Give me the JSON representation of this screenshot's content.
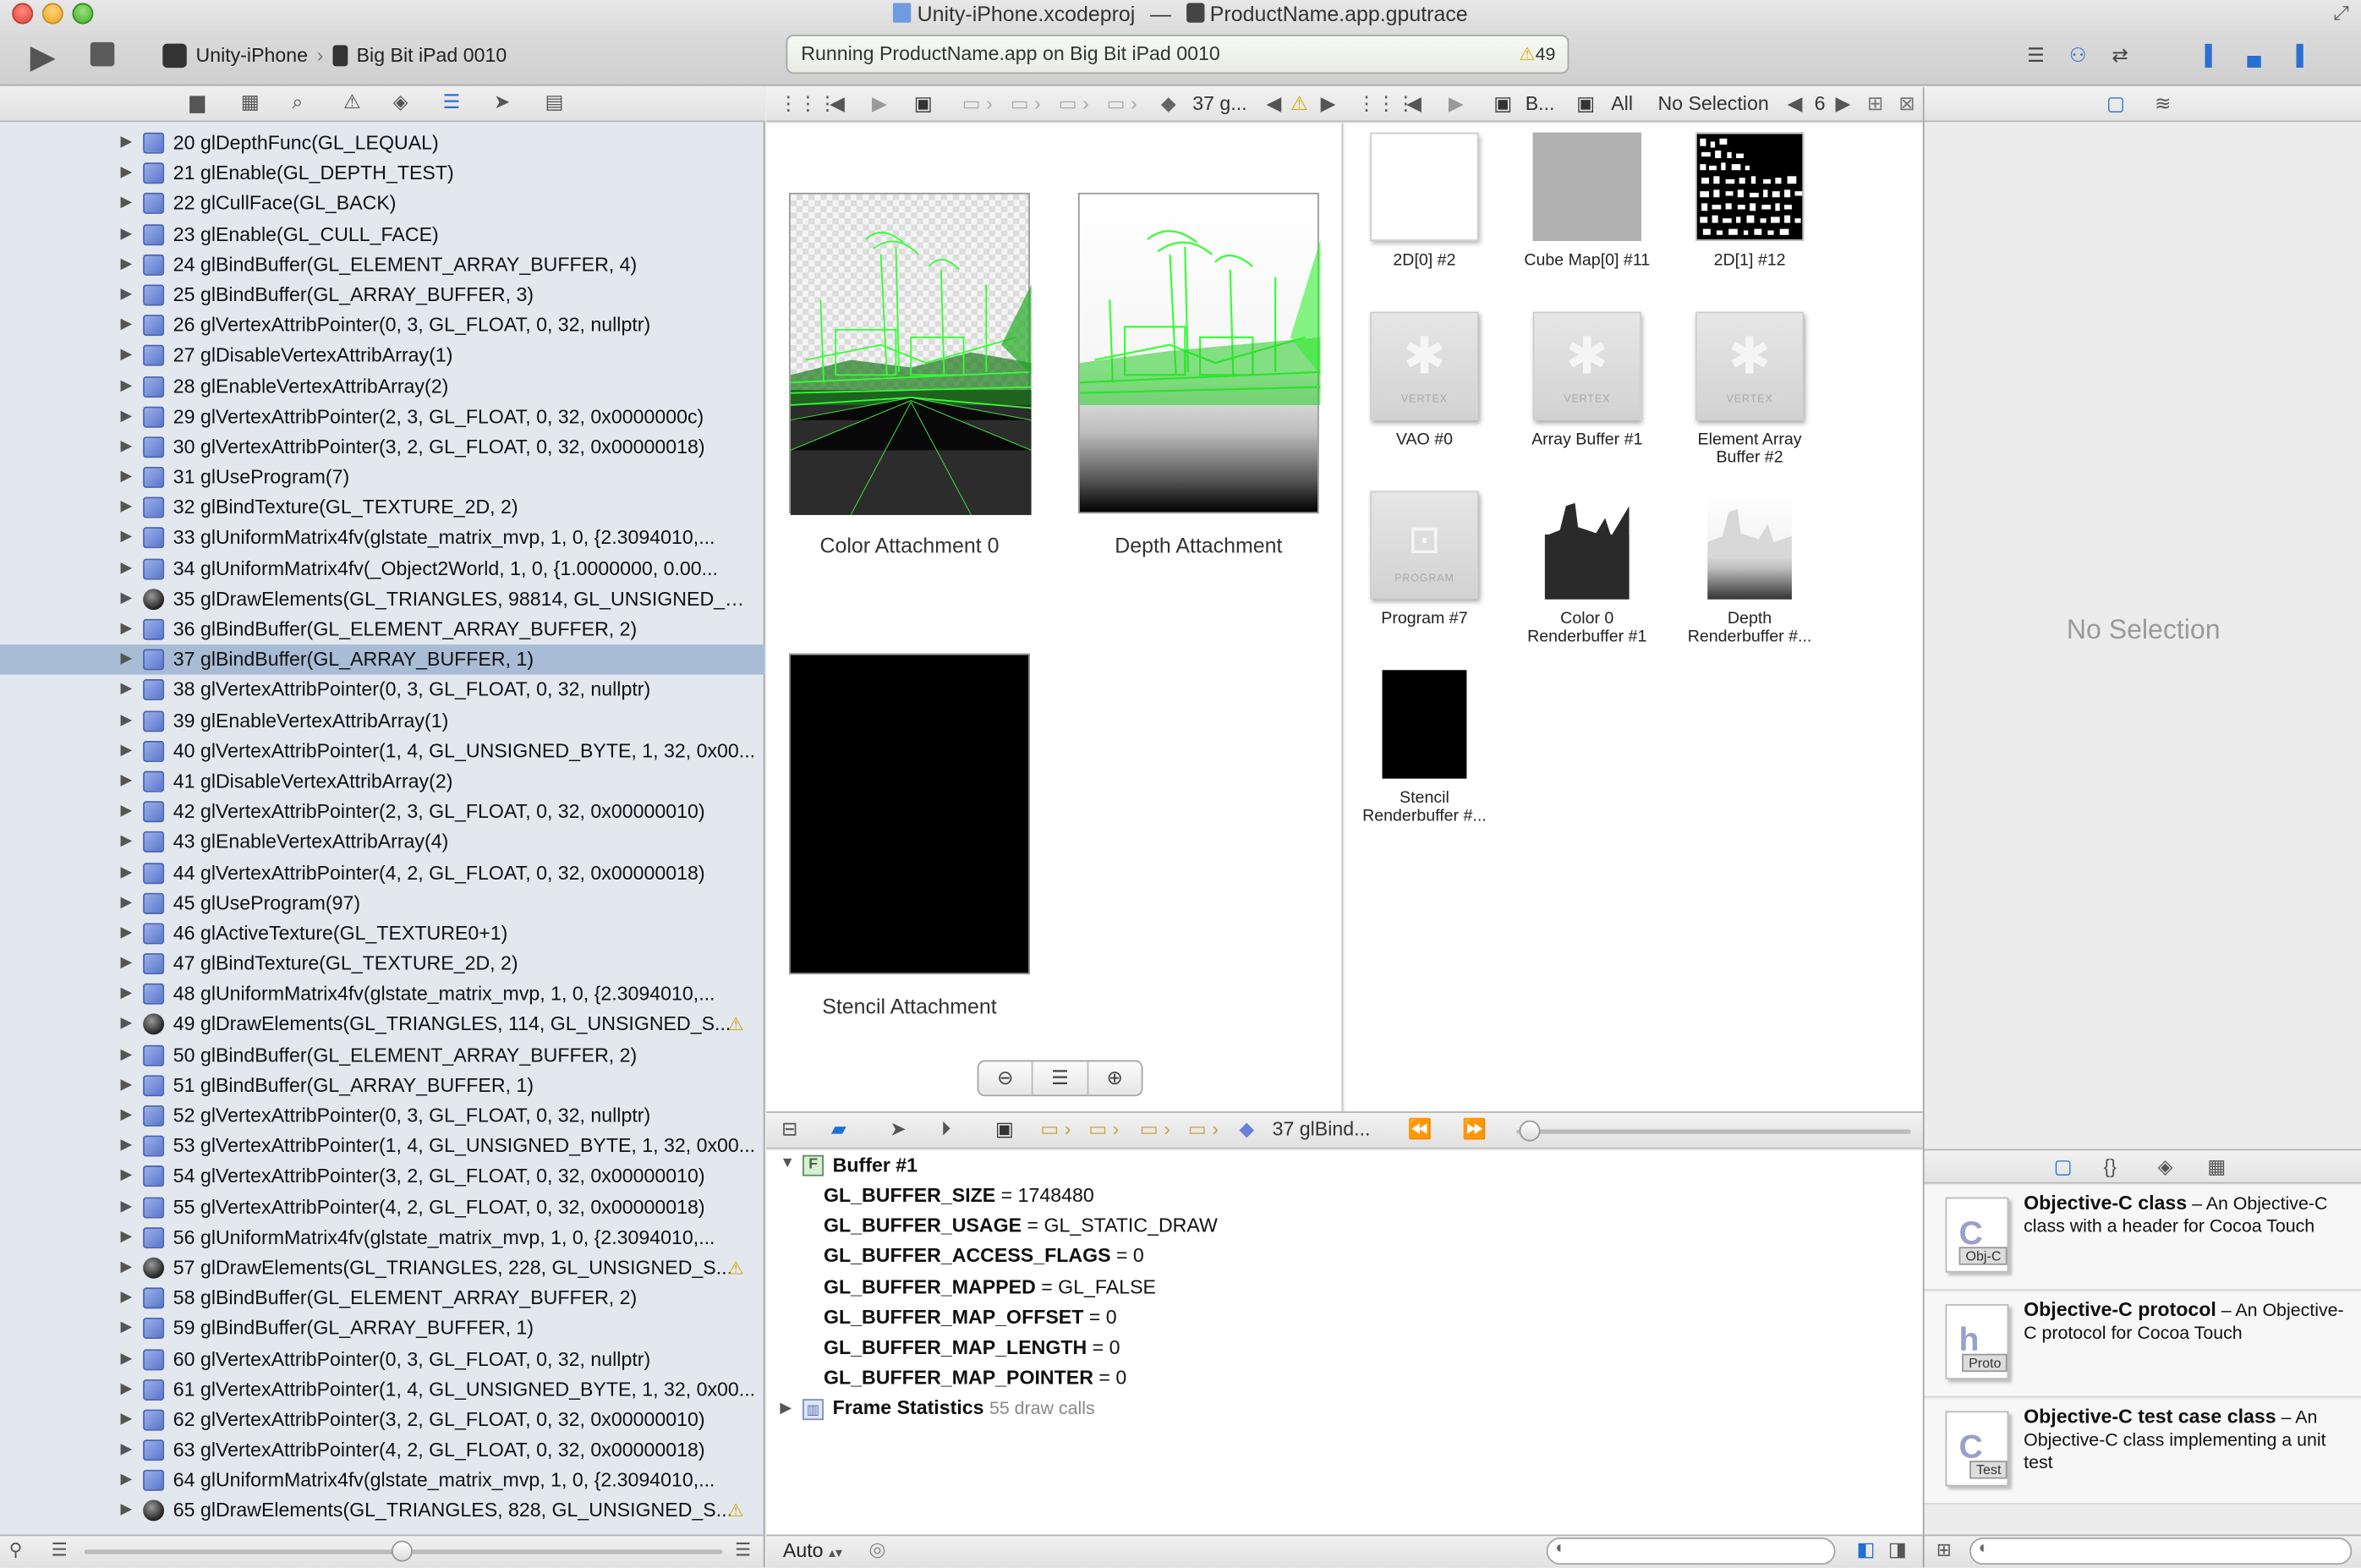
{
  "window": {
    "title_project": "Unity-iPhone.xcodeproj",
    "title_sep": "—",
    "title_trace": "ProductName.app.gputrace"
  },
  "toolbar": {
    "scheme": "Unity-iPhone",
    "scheme_sep": "›",
    "device": "Big Bit iPad 0010",
    "status": "Running ProductName.app on Big Bit iPad 0010",
    "warning_count": "49"
  },
  "navigator": {
    "selected_index": 17,
    "rows": [
      {
        "text": "20 glDepthFunc(GL_LEQUAL)",
        "kind": "cube",
        "warn": false
      },
      {
        "text": "21 glEnable(GL_DEPTH_TEST)",
        "kind": "cube",
        "warn": false
      },
      {
        "text": "22 glCullFace(GL_BACK)",
        "kind": "cube",
        "warn": false
      },
      {
        "text": "23 glEnable(GL_CULL_FACE)",
        "kind": "cube",
        "warn": false
      },
      {
        "text": "24 glBindBuffer(GL_ELEMENT_ARRAY_BUFFER, 4)",
        "kind": "cube",
        "warn": false
      },
      {
        "text": "25 glBindBuffer(GL_ARRAY_BUFFER, 3)",
        "kind": "cube",
        "warn": false
      },
      {
        "text": "26 glVertexAttribPointer(0, 3, GL_FLOAT, 0, 32, nullptr)",
        "kind": "cube",
        "warn": false
      },
      {
        "text": "27 glDisableVertexAttribArray(1)",
        "kind": "cube",
        "warn": false
      },
      {
        "text": "28 glEnableVertexAttribArray(2)",
        "kind": "cube",
        "warn": false
      },
      {
        "text": "29 glVertexAttribPointer(2, 3, GL_FLOAT, 0, 32, 0x0000000c)",
        "kind": "cube",
        "warn": false
      },
      {
        "text": "30 glVertexAttribPointer(3, 2, GL_FLOAT, 0, 32, 0x00000018)",
        "kind": "cube",
        "warn": false
      },
      {
        "text": "31 glUseProgram(7)",
        "kind": "cube",
        "warn": false
      },
      {
        "text": "32 glBindTexture(GL_TEXTURE_2D, 2)",
        "kind": "cube",
        "warn": false
      },
      {
        "text": "33 glUniformMatrix4fv(glstate_matrix_mvp, 1, 0, {2.3094010,...",
        "kind": "cube",
        "warn": false
      },
      {
        "text": "34 glUniformMatrix4fv(_Object2World, 1, 0, {1.0000000, 0.00...",
        "kind": "cube",
        "warn": false
      },
      {
        "text": "35 glDrawElements(GL_TRIANGLES, 98814, GL_UNSIGNED_SHO...",
        "kind": "ball",
        "warn": false
      },
      {
        "text": "36 glBindBuffer(GL_ELEMENT_ARRAY_BUFFER, 2)",
        "kind": "cube",
        "warn": false
      },
      {
        "text": "37 glBindBuffer(GL_ARRAY_BUFFER, 1)",
        "kind": "cube",
        "warn": false
      },
      {
        "text": "38 glVertexAttribPointer(0, 3, GL_FLOAT, 0, 32, nullptr)",
        "kind": "cube",
        "warn": false
      },
      {
        "text": "39 glEnableVertexAttribArray(1)",
        "kind": "cube",
        "warn": false
      },
      {
        "text": "40 glVertexAttribPointer(1, 4, GL_UNSIGNED_BYTE, 1, 32, 0x00...",
        "kind": "cube",
        "warn": false
      },
      {
        "text": "41 glDisableVertexAttribArray(2)",
        "kind": "cube",
        "warn": false
      },
      {
        "text": "42 glVertexAttribPointer(2, 3, GL_FLOAT, 0, 32, 0x00000010)",
        "kind": "cube",
        "warn": false
      },
      {
        "text": "43 glEnableVertexAttribArray(4)",
        "kind": "cube",
        "warn": false
      },
      {
        "text": "44 glVertexAttribPointer(4, 2, GL_FLOAT, 0, 32, 0x00000018)",
        "kind": "cube",
        "warn": false
      },
      {
        "text": "45 glUseProgram(97)",
        "kind": "cube",
        "warn": false
      },
      {
        "text": "46 glActiveTexture(GL_TEXTURE0+1)",
        "kind": "cube",
        "warn": false
      },
      {
        "text": "47 glBindTexture(GL_TEXTURE_2D, 2)",
        "kind": "cube",
        "warn": false
      },
      {
        "text": "48 glUniformMatrix4fv(glstate_matrix_mvp, 1, 0, {2.3094010,...",
        "kind": "cube",
        "warn": false
      },
      {
        "text": "49 glDrawElements(GL_TRIANGLES, 114, GL_UNSIGNED_S...",
        "kind": "ball",
        "warn": true
      },
      {
        "text": "50 glBindBuffer(GL_ELEMENT_ARRAY_BUFFER, 2)",
        "kind": "cube",
        "warn": false
      },
      {
        "text": "51 glBindBuffer(GL_ARRAY_BUFFER, 1)",
        "kind": "cube",
        "warn": false
      },
      {
        "text": "52 glVertexAttribPointer(0, 3, GL_FLOAT, 0, 32, nullptr)",
        "kind": "cube",
        "warn": false
      },
      {
        "text": "53 glVertexAttribPointer(1, 4, GL_UNSIGNED_BYTE, 1, 32, 0x00...",
        "kind": "cube",
        "warn": false
      },
      {
        "text": "54 glVertexAttribPointer(3, 2, GL_FLOAT, 0, 32, 0x00000010)",
        "kind": "cube",
        "warn": false
      },
      {
        "text": "55 glVertexAttribPointer(4, 2, GL_FLOAT, 0, 32, 0x00000018)",
        "kind": "cube",
        "warn": false
      },
      {
        "text": "56 glUniformMatrix4fv(glstate_matrix_mvp, 1, 0, {2.3094010,...",
        "kind": "cube",
        "warn": false
      },
      {
        "text": "57 glDrawElements(GL_TRIANGLES, 228, GL_UNSIGNED_S...",
        "kind": "ball",
        "warn": true
      },
      {
        "text": "58 glBindBuffer(GL_ELEMENT_ARRAY_BUFFER, 2)",
        "kind": "cube",
        "warn": false
      },
      {
        "text": "59 glBindBuffer(GL_ARRAY_BUFFER, 1)",
        "kind": "cube",
        "warn": false
      },
      {
        "text": "60 glVertexAttribPointer(0, 3, GL_FLOAT, 0, 32, nullptr)",
        "kind": "cube",
        "warn": false
      },
      {
        "text": "61 glVertexAttribPointer(1, 4, GL_UNSIGNED_BYTE, 1, 32, 0x00...",
        "kind": "cube",
        "warn": false
      },
      {
        "text": "62 glVertexAttribPointer(3, 2, GL_FLOAT, 0, 32, 0x00000010)",
        "kind": "cube",
        "warn": false
      },
      {
        "text": "63 glVertexAttribPointer(4, 2, GL_FLOAT, 0, 32, 0x00000018)",
        "kind": "cube",
        "warn": false
      },
      {
        "text": "64 glUniformMatrix4fv(glstate_matrix_mvp, 1, 0, {2.3094010,...",
        "kind": "cube",
        "warn": false
      },
      {
        "text": "65 glDrawElements(GL_TRIANGLES, 828, GL_UNSIGNED_S...",
        "kind": "ball",
        "warn": true
      }
    ]
  },
  "editor": {
    "jump_left_item": "37 g...",
    "jump_right_b": "B...",
    "jump_right_all": "All",
    "jump_right_nosel": "No Selection",
    "jump_right_count": "6"
  },
  "framebuffer": {
    "color_label": "Color Attachment 0",
    "depth_label": "Depth Attachment",
    "stencil_label": "Stencil Attachment"
  },
  "resources": [
    {
      "label": "2D[0] #2",
      "label2": ""
    },
    {
      "label": "Cube Map[0] #11",
      "label2": ""
    },
    {
      "label": "2D[1] #12",
      "label2": ""
    },
    {
      "label": "VAO #0",
      "label2": "",
      "thumb_text": "VERTEX"
    },
    {
      "label": "Array Buffer #1",
      "label2": "",
      "thumb_text": "VERTEX"
    },
    {
      "label": "Element Array",
      "label2": "Buffer #2",
      "thumb_text": "VERTEX"
    },
    {
      "label": "Program #7",
      "label2": "",
      "thumb_text": "PROGRAM"
    },
    {
      "label": "Color 0",
      "label2": "Renderbuffer #1"
    },
    {
      "label": "Depth",
      "label2": "Renderbuffer #..."
    },
    {
      "label": "Stencil",
      "label2": "Renderbuffer #..."
    }
  ],
  "debug": {
    "jump_item": "37 glBind...",
    "buffer_title": "Buffer #1",
    "buffer_badge": "F",
    "props": [
      {
        "key": "GL_BUFFER_SIZE",
        "val": " = 1748480"
      },
      {
        "key": "GL_BUFFER_USAGE",
        "val": " = GL_STATIC_DRAW"
      },
      {
        "key": "GL_BUFFER_ACCESS_FLAGS",
        "val": " = 0"
      },
      {
        "key": "GL_BUFFER_MAPPED",
        "val": " = GL_FALSE"
      },
      {
        "key": "GL_BUFFER_MAP_OFFSET",
        "val": " = 0"
      },
      {
        "key": "GL_BUFFER_MAP_LENGTH",
        "val": " = 0"
      },
      {
        "key": "GL_BUFFER_MAP_POINTER",
        "val": " = 0"
      }
    ],
    "frame_stats_title": "Frame Statistics",
    "frame_stats_detail": "55 draw calls",
    "auto_label": "Auto"
  },
  "inspector": {
    "no_selection": "No Selection"
  },
  "library": {
    "templates": [
      {
        "title": "Objective-C class",
        "desc": " – An Objective-C class with a header for Cocoa Touch",
        "icon_letter": "C",
        "tag": "Obj-C"
      },
      {
        "title": "Objective-C protocol",
        "desc": " – An Objective-C protocol for Cocoa Touch",
        "icon_letter": "h",
        "tag": "Proto"
      },
      {
        "title": "Objective-C test case class",
        "desc": " – An Objective-C class implementing a unit test",
        "icon_letter": "C",
        "tag": "Test"
      }
    ]
  },
  "icons": {
    "run": "play-icon",
    "stop": "stop-icon",
    "warning": "warning-icon"
  },
  "colors": {
    "selection": "#a9bcd6",
    "navigator_bg": "#e3e8ef",
    "wireframe_green": "#33ff33",
    "warning_yellow": "#f2b600",
    "debug_accent": "#1f6fd6"
  }
}
